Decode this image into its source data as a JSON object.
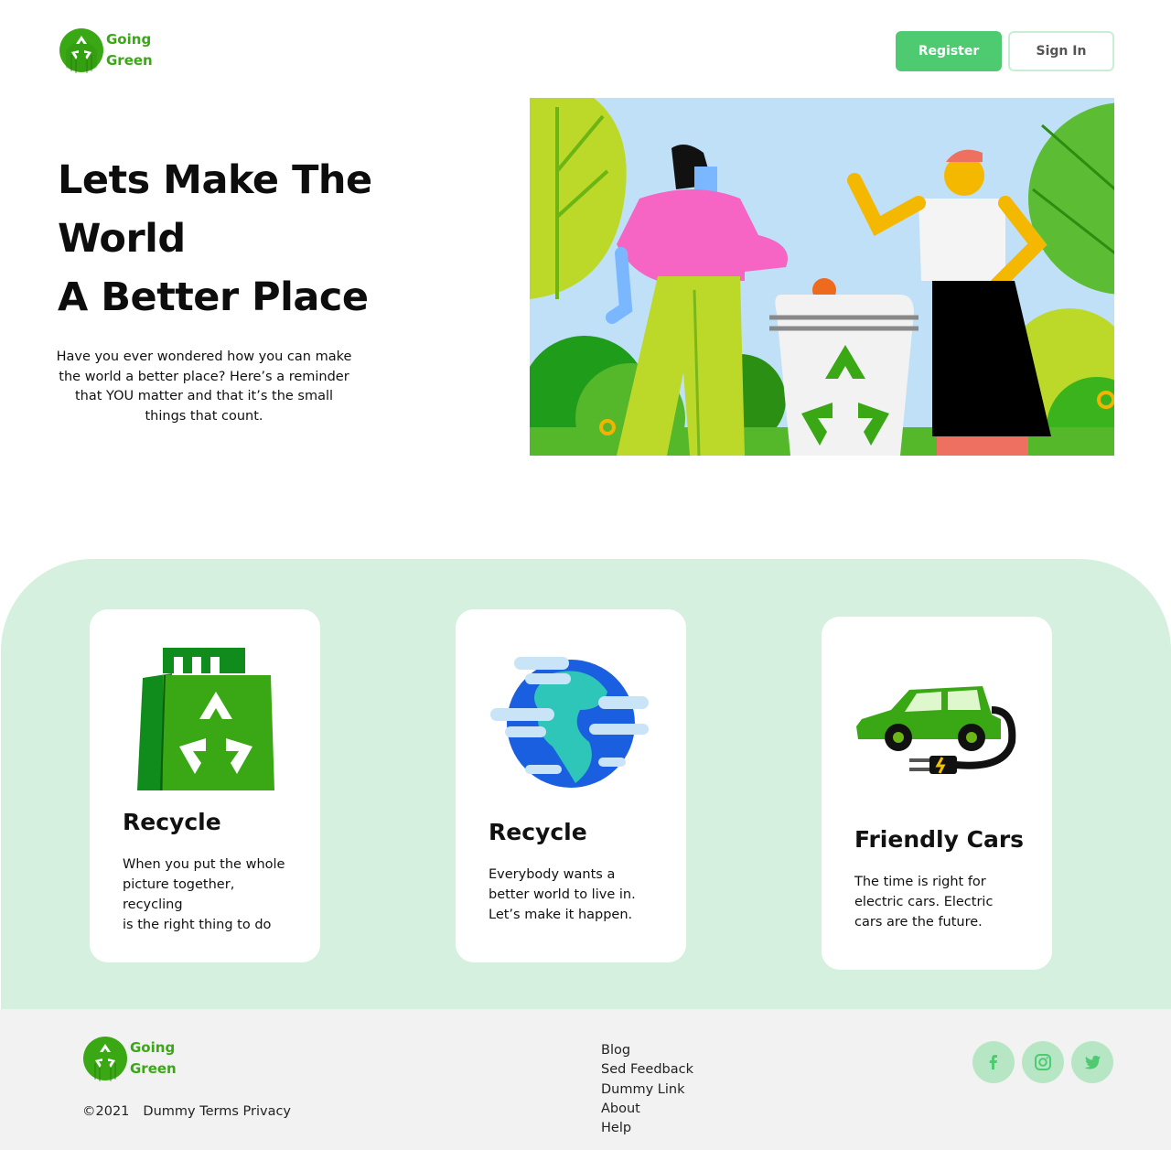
{
  "brand": {
    "line1": "Going",
    "line2": "Green",
    "accent": "#3aa815",
    "button_green": "#4ecb71",
    "band_color": "#d5f0df"
  },
  "header": {
    "register_label": "Register",
    "signin_label": "Sign In"
  },
  "hero": {
    "title_lines": [
      "Lets Make The",
      "World",
      "A Better Place"
    ],
    "description": "Have you ever wondered how you can make the world a better place? Here’s a reminder that YOU matter and that it’s the small things that count.",
    "illustration": "people-recycling-illustration"
  },
  "cards": [
    {
      "icon": "recycle-bag-icon",
      "title": "Recycle",
      "text": "When you put the whole\npicture together,\nrecycling\n is the right thing to do"
    },
    {
      "icon": "earth-globe-icon",
      "title": "Recycle",
      "text": "Everybody wants a\nbetter world to live in.\nLet’s make it happen."
    },
    {
      "icon": "electric-car-icon",
      "title": "Friendly Cars",
      "text": "The time is right for\nelectric cars. Electric\ncars are the future."
    }
  ],
  "footer": {
    "copyright": "©2021",
    "legal": "Dummy Terms Privacy",
    "links": [
      "Blog",
      "Sed Feedback",
      "Dummy Link",
      "About",
      "Help"
    ],
    "social": [
      "facebook-icon",
      "instagram-icon",
      "twitter-icon"
    ]
  }
}
